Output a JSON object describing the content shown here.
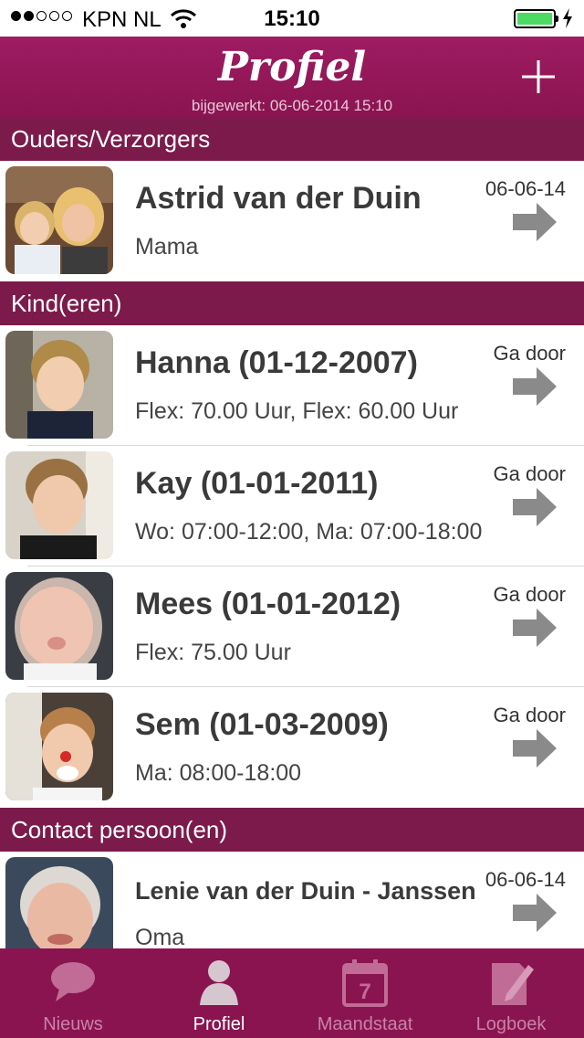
{
  "status": {
    "carrier": "KPN NL",
    "time": "15:10"
  },
  "header": {
    "title": "Profiel",
    "updated": "bijgewerkt: 06-06-2014 15:10"
  },
  "sections": {
    "parents": "Ouders/Verzorgers",
    "children": "Kind(eren)",
    "contacts": "Contact persoon(en)"
  },
  "parents": [
    {
      "name": "Astrid van der Duin",
      "role": "Mama",
      "date": "06-06-14"
    }
  ],
  "children": [
    {
      "name": "Hanna (01-12-2007)",
      "detail": "Flex: 70.00 Uur, Flex: 60.00 Uur",
      "action": "Ga door"
    },
    {
      "name": "Kay (01-01-2011)",
      "detail": "Wo: 07:00-12:00, Ma: 07:00-18:00",
      "action": "Ga door"
    },
    {
      "name": "Mees (01-01-2012)",
      "detail": "Flex: 75.00 Uur",
      "action": "Ga door"
    },
    {
      "name": "Sem (01-03-2009)",
      "detail": "Ma: 08:00-18:00",
      "action": "Ga door"
    }
  ],
  "contacts": [
    {
      "name": "Lenie van der Duin - Janssen",
      "role": "Oma",
      "date": "06-06-14"
    }
  ],
  "tabs": [
    {
      "label": "Nieuws",
      "icon": "speech-bubble-icon"
    },
    {
      "label": "Profiel",
      "icon": "person-icon",
      "active": true
    },
    {
      "label": "Maandstaat",
      "icon": "calendar-icon",
      "day": "7"
    },
    {
      "label": "Logboek",
      "icon": "notebook-pencil-icon"
    }
  ],
  "colors": {
    "accent": "#8a1450",
    "section": "#7c1b4b",
    "battery": "#4cd964",
    "arrow": "#8a8a8a"
  }
}
